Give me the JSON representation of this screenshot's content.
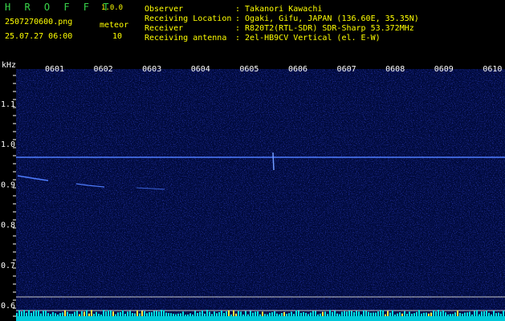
{
  "app": {
    "name": "H R O F F T",
    "version": "1.0.0"
  },
  "file": {
    "name": "2507270600.png",
    "datetime": "25.07.27 06:00"
  },
  "meteor": {
    "label": "meteor",
    "count": "10"
  },
  "info": {
    "observer_key": "Observer",
    "observer_val": ": Takanori Kawachi",
    "location_key": "Receiving Location",
    "location_val": ": Ogaki, Gifu, JAPAN (136.60E, 35.35N)",
    "receiver_key": "Receiver",
    "receiver_val": ": R820T2(RTL-SDR) SDR-Sharp 53.372MHz",
    "antenna_key": "Receiving antenna",
    "antenna_val": ": 2el-HB9CV Vertical (el. E-W)"
  },
  "axes": {
    "y_unit": "kHz",
    "y_ticks": [
      "1.1",
      "1.0",
      "0.9",
      "0.8",
      "0.7",
      "0.6"
    ],
    "x_ticks": [
      "0601",
      "0602",
      "0603",
      "0604",
      "0605",
      "0606",
      "0607",
      "0608",
      "0609",
      "0610"
    ]
  },
  "colors": {
    "header_green": "#39d64a",
    "header_yellow": "#ffff00",
    "signal": "#4f7dff",
    "baseline": "#00e5e5"
  }
}
